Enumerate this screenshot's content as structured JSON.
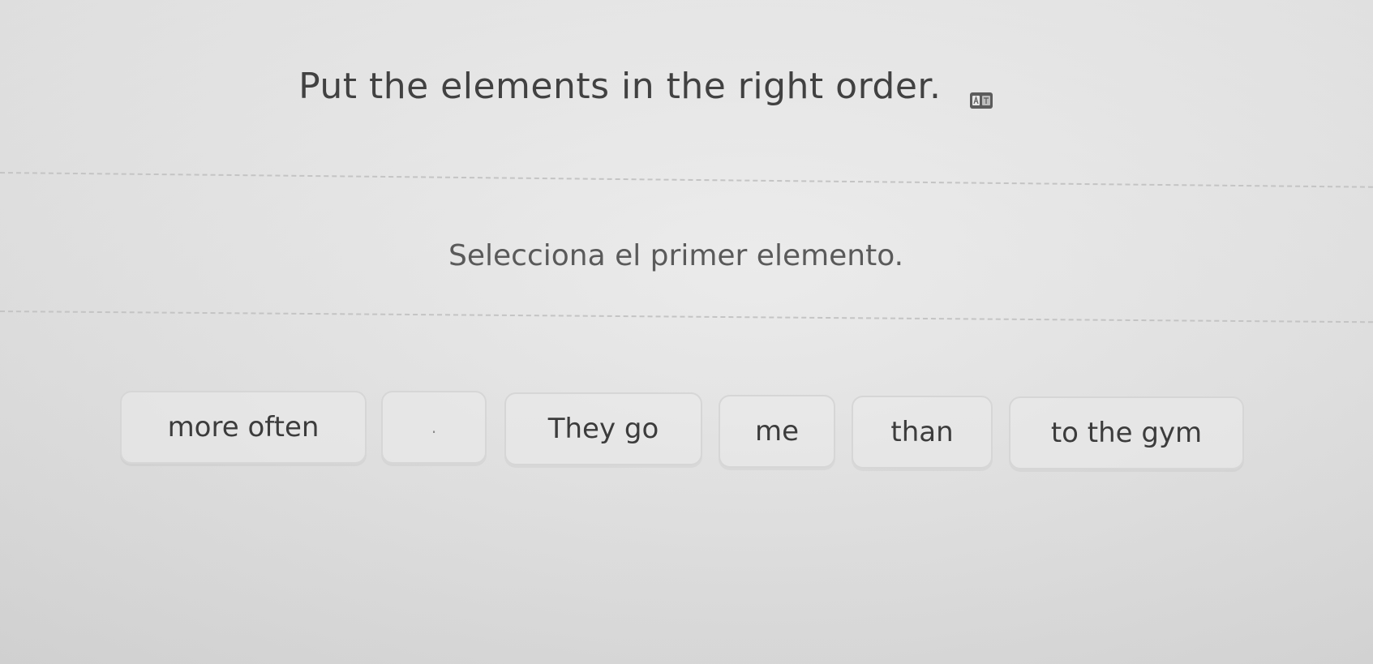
{
  "exercise": {
    "instruction": "Put the elements in the right order.",
    "translate_icon": "translate-icon",
    "prompt": "Selecciona el primer elemento."
  },
  "chips": [
    {
      "label": "more often"
    },
    {
      "label": "."
    },
    {
      "label": "They go"
    },
    {
      "label": "me"
    },
    {
      "label": "than"
    },
    {
      "label": "to the gym"
    }
  ]
}
